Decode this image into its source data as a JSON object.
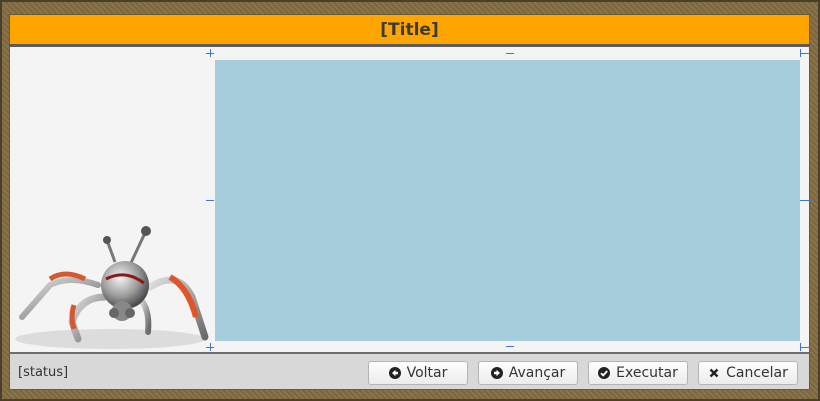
{
  "window": {
    "title": "[Title]"
  },
  "status": {
    "text": "[status]"
  },
  "buttons": {
    "back": {
      "label": "Voltar",
      "icon": "arrow-left-circle-icon"
    },
    "next": {
      "label": "Avançar",
      "icon": "arrow-right-circle-icon"
    },
    "execute": {
      "label": "Executar",
      "icon": "check-circle-icon"
    },
    "cancel": {
      "label": "Cancelar",
      "icon": "close-icon"
    }
  },
  "colors": {
    "title_bar": "#ffa500",
    "content_area": "#a6cddb"
  },
  "images": {
    "mascot": "robot-spider-illustration"
  }
}
